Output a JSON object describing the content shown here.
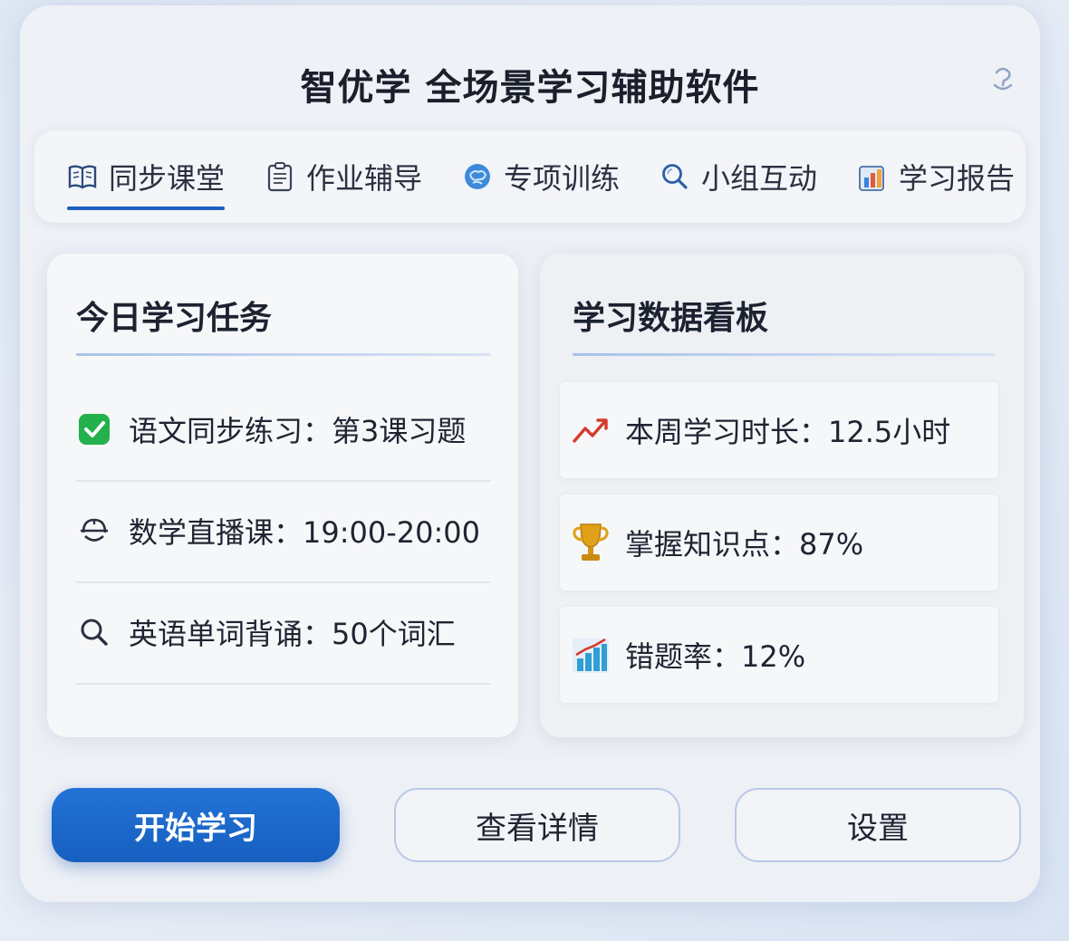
{
  "app": {
    "title": "智优学 全场景学习辅助软件"
  },
  "tabs": [
    {
      "label": "同步课堂",
      "icon": "book-icon",
      "active": true
    },
    {
      "label": "作业辅导",
      "icon": "clipboard-icon",
      "active": false
    },
    {
      "label": "专项训练",
      "icon": "brain-icon",
      "active": false
    },
    {
      "label": "小组互动",
      "icon": "search-icon",
      "active": false
    },
    {
      "label": "学习报告",
      "icon": "report-chart-icon",
      "active": false
    }
  ],
  "tasks": {
    "title": "今日学习任务",
    "items": [
      {
        "label": "语文同步练习：第3课习题",
        "icon": "check-icon"
      },
      {
        "label": "数学直播课：19:00-20:00",
        "icon": "headset-icon"
      },
      {
        "label": "英语单词背诵：50个词汇",
        "icon": "search-icon"
      }
    ]
  },
  "dashboard": {
    "title": "学习数据看板",
    "items": [
      {
        "label": "本周学习时长：12.5小时",
        "icon": "trend-up-icon"
      },
      {
        "label": "掌握知识点：87%",
        "icon": "trophy-icon"
      },
      {
        "label": "错题率：12%",
        "icon": "bar-chart-icon"
      }
    ]
  },
  "actions": {
    "start": "开始学习",
    "details": "查看详情",
    "settings": "设置"
  },
  "colors": {
    "accent": "#1f5fc0",
    "primary_button": "#1a68cc",
    "check_green": "#22b14c",
    "trend_red": "#d43a2c",
    "trophy_gold": "#e0a019"
  }
}
